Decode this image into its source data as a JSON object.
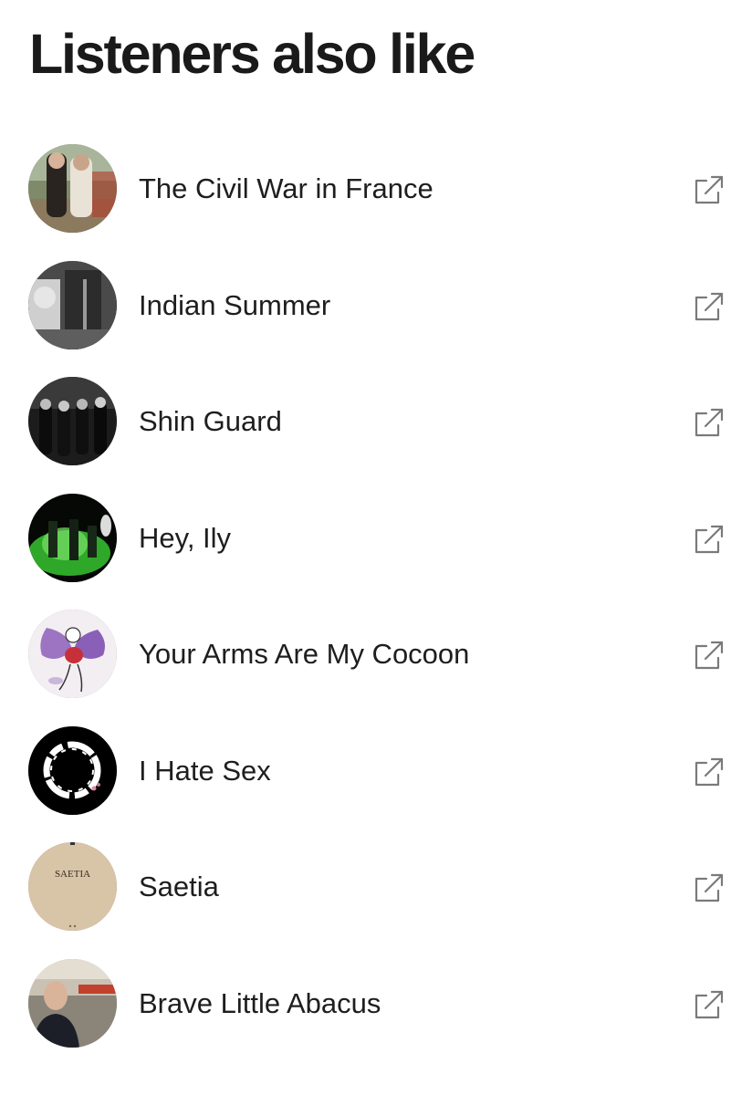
{
  "page": {
    "title": "Listeners also like"
  },
  "artists": [
    {
      "name": "The Civil War in France",
      "avatar_icon": "photo-two-people-outdoors"
    },
    {
      "name": "Indian Summer",
      "avatar_icon": "photo-band-grayscale"
    },
    {
      "name": "Shin Guard",
      "avatar_icon": "photo-band-dark"
    },
    {
      "name": "Hey, Ily",
      "avatar_icon": "photo-live-green-stage"
    },
    {
      "name": "Your Arms Are My Cocoon",
      "avatar_icon": "illustration-butterfly-figure"
    },
    {
      "name": "I Hate Sex",
      "avatar_icon": "white-ring-on-black"
    },
    {
      "name": "Saetia",
      "avatar_icon": "beige-cover",
      "avatar_text": "SAETIA"
    },
    {
      "name": "Brave Little Abacus",
      "avatar_icon": "photo-person-portrait"
    }
  ],
  "icons": {
    "external_link": "external-link-icon"
  },
  "colors": {
    "text": "#1a1a1a",
    "icon": "#7a7a7a",
    "background": "#ffffff"
  }
}
